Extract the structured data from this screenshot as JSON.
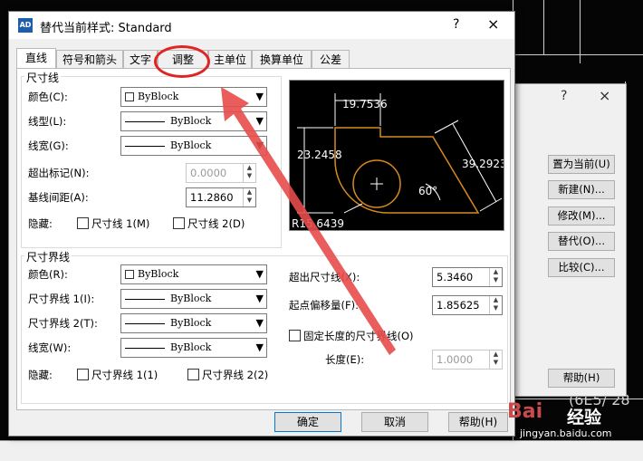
{
  "dialog": {
    "title": "替代当前样式: Standard",
    "help_icon": "?",
    "close_icon": "×"
  },
  "tabs": [
    "直线",
    "符号和箭头",
    "文字",
    "调整",
    "主单位",
    "换算单位",
    "公差"
  ],
  "dim_lines": {
    "group_label": "尺寸线",
    "color_label": "颜色(C):",
    "color_value": "ByBlock",
    "linetype_label": "线型(L):",
    "linetype_value": "ByBlock",
    "lineweight_label": "线宽(G):",
    "lineweight_value": "ByBlock",
    "extend_label": "超出标记(N):",
    "extend_value": "0.0000",
    "baseline_label": "基线间距(A):",
    "baseline_value": "11.2860",
    "suppress_label": "隐藏:",
    "suppress_1": "尺寸线 1(M)",
    "suppress_2": "尺寸线 2(D)"
  },
  "ext_lines": {
    "group_label": "尺寸界线",
    "color_label": "颜色(R):",
    "color_value": "ByBlock",
    "lt1_label": "尺寸界线 1(I):",
    "lt1_value": "ByBlock",
    "lt2_label": "尺寸界线 2(T):",
    "lt2_value": "ByBlock",
    "lineweight_label": "线宽(W):",
    "lineweight_value": "ByBlock",
    "suppress_label": "隐藏:",
    "suppress_1": "尺寸界线 1(1)",
    "suppress_2": "尺寸界线 2(2)",
    "beyond_label": "超出尺寸线(X):",
    "beyond_value": "5.3460",
    "offset_label": "起点偏移量(F):",
    "offset_value": "1.85625",
    "fixed_label": "固定长度的尺寸界线(O)",
    "length_label": "长度(E):",
    "length_value": "1.0000"
  },
  "preview": {
    "dim_top": "19.7536",
    "dim_left": "23.2458",
    "dim_right": "39.2923",
    "angle": "60°",
    "radius": "R15.6439"
  },
  "buttons": {
    "ok": "确定",
    "cancel": "取消",
    "help": "帮助(H)"
  },
  "back_dialog": {
    "help_icon": "?",
    "close_icon": "×",
    "set_current": "置为当前(U)",
    "new": "新建(N)...",
    "modify": "修改(M)...",
    "override": "替代(O)...",
    "compare": "比较(C)...",
    "help": "帮助(H)"
  },
  "background": {
    "cad_text": "(6E5/ 28"
  },
  "watermark": {
    "brand": "Bai",
    "brand_cn": "经验",
    "url": "jingyan.baidu.com"
  },
  "colors": {
    "highlight": "#e32222",
    "arrow": "#e84b4b",
    "preview_geometry": "#d98a1e"
  }
}
